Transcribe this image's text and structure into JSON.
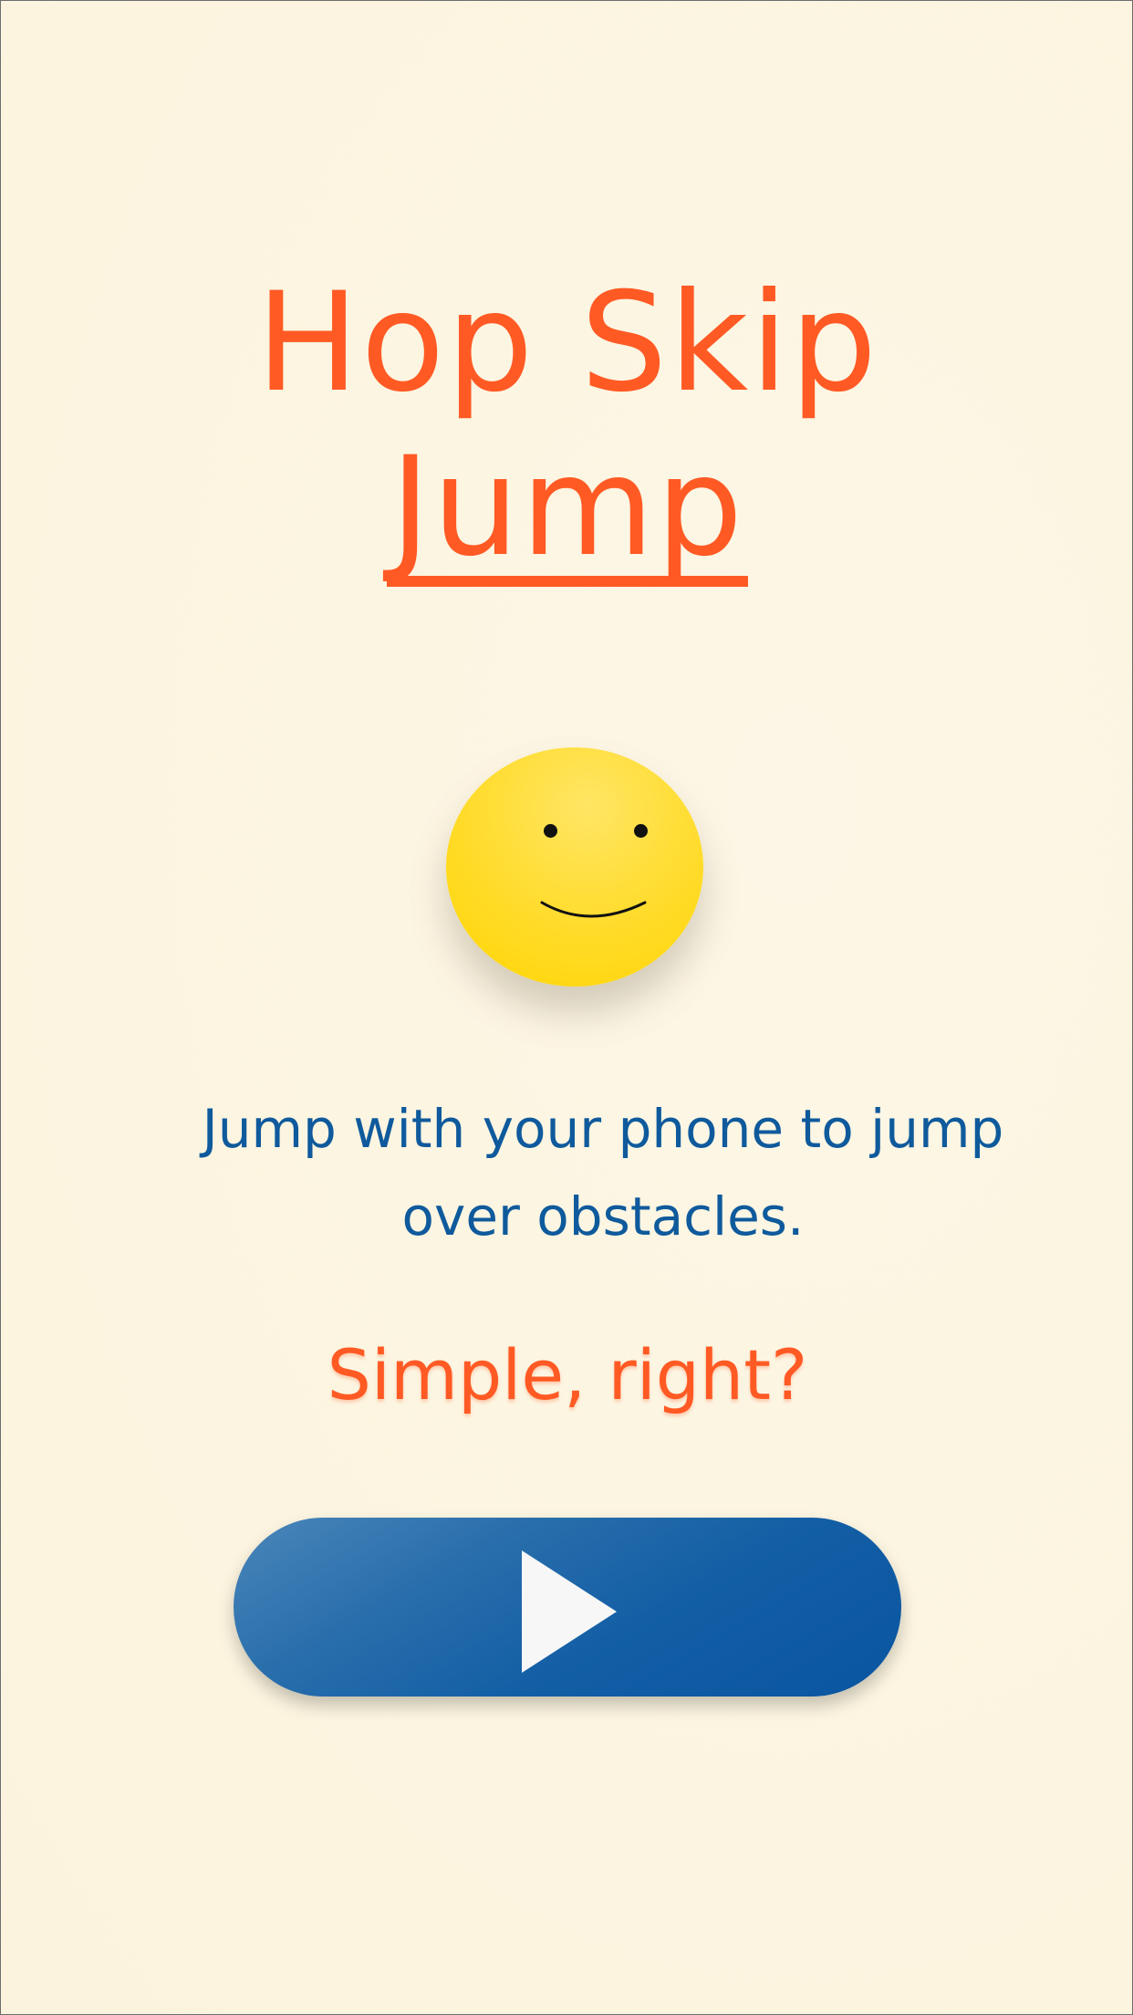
{
  "title": {
    "line1": "Hop Skip",
    "line2": "Jump"
  },
  "mascot": {
    "icon": "smiley-face-icon",
    "color": "#ffd500"
  },
  "description": "Jump with your phone to jump over obstacles.",
  "subtitle": "Simple, right?",
  "play_button": {
    "icon": "play-icon",
    "color": "#135ea5"
  },
  "colors": {
    "title": "#ff5a24",
    "description": "#0f5a9c",
    "background": "#fcf5e1"
  }
}
